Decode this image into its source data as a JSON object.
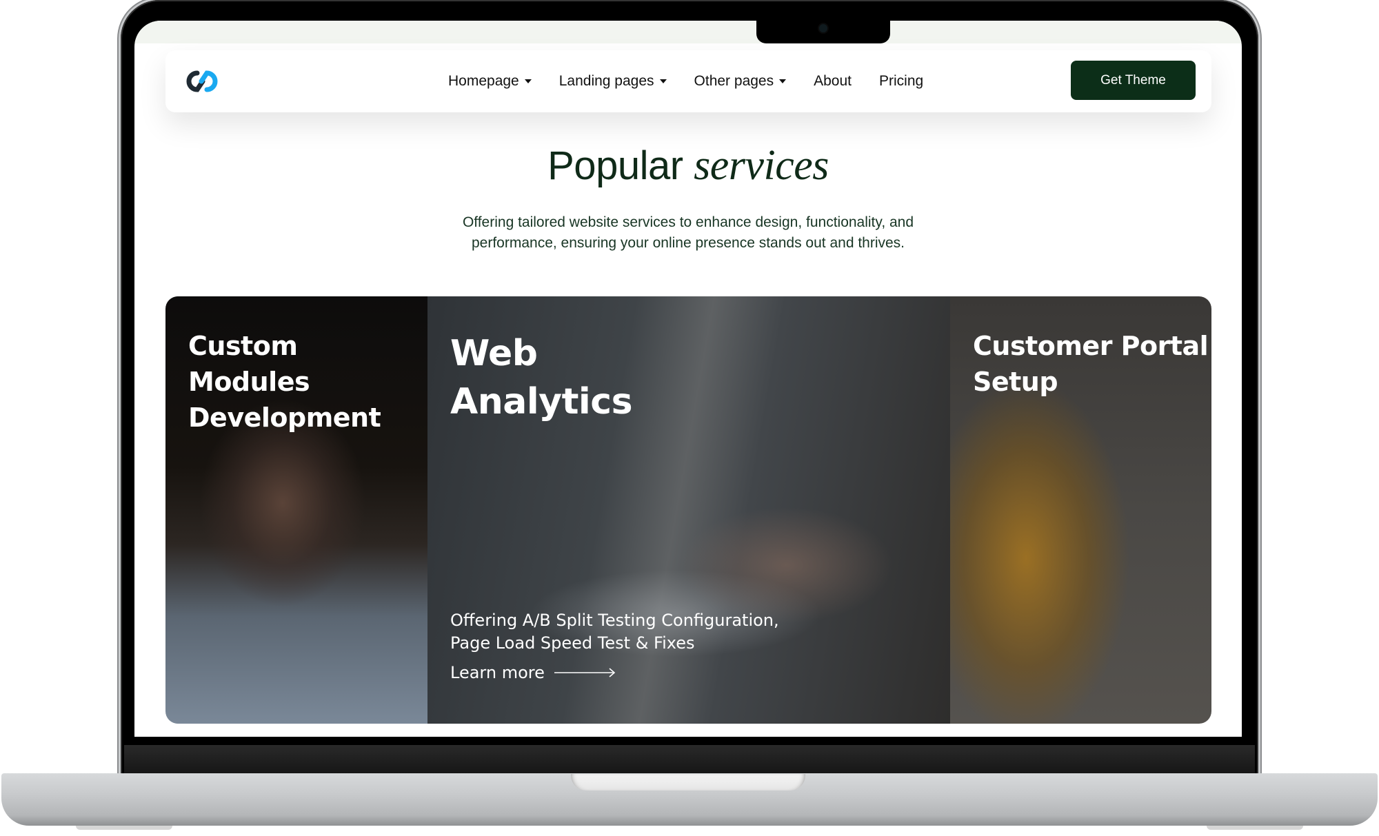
{
  "nav": {
    "logo": "infinity-link-logo",
    "items": [
      {
        "label": "Homepage",
        "dropdown": true
      },
      {
        "label": "Landing pages",
        "dropdown": true
      },
      {
        "label": "Other pages",
        "dropdown": true
      },
      {
        "label": "About",
        "dropdown": false
      },
      {
        "label": "Pricing",
        "dropdown": false
      }
    ],
    "cta_label": "Get Theme"
  },
  "section": {
    "title_plain": "Popular",
    "title_italic": "services",
    "subtitle_line1": "Offering tailored website services to enhance design, functionality, and",
    "subtitle_line2": "performance, ensuring your online presence stands out and thrives."
  },
  "cards": [
    {
      "title_line1": "Custom Modules",
      "title_line2": "Development"
    },
    {
      "title_line1": "Web",
      "title_line2": "Analytics",
      "desc_line1": "Offering A/B Split Testing Configuration,",
      "desc_line2": "Page Load Speed Test & Fixes",
      "link_label": "Learn more"
    },
    {
      "title_line1": "Customer Portal",
      "title_line2": "Setup"
    }
  ],
  "colors": {
    "brand_dark": "#0c2e18",
    "logo_dark": "#1f2a33",
    "logo_blue": "#1aa9f0",
    "heading": "#0f2a18"
  }
}
